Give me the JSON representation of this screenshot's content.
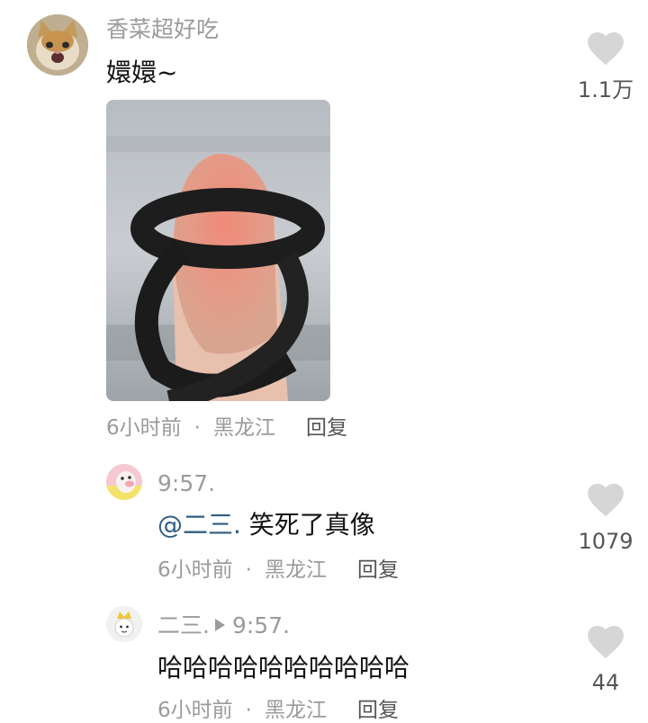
{
  "comment": {
    "username": "香菜超好吃",
    "text": "嬛嬛~",
    "time": "6小时前",
    "separator": "·",
    "location": "黑龙江",
    "reply_label": "回复",
    "like_count": "1.1万"
  },
  "replies": [
    {
      "username": "9:57.",
      "mention": "@二三.",
      "text": " 笑死了真像",
      "time": "6小时前",
      "separator": "·",
      "location": "黑龙江",
      "reply_label": "回复",
      "like_count": "1079"
    },
    {
      "username": "二三.",
      "reply_to": "9:57.",
      "text": "哈哈哈哈哈哈哈哈哈哈",
      "time": "6小时前",
      "separator": "·",
      "location": "黑龙江",
      "reply_label": "回复",
      "like_count": "44"
    }
  ],
  "icons": {
    "like": "heart-icon",
    "reply_arrow": "triangle-right-icon"
  },
  "colors": {
    "muted_text": "#9b9b9b",
    "mention": "#2f5d86",
    "heart": "#d6d6d6"
  }
}
